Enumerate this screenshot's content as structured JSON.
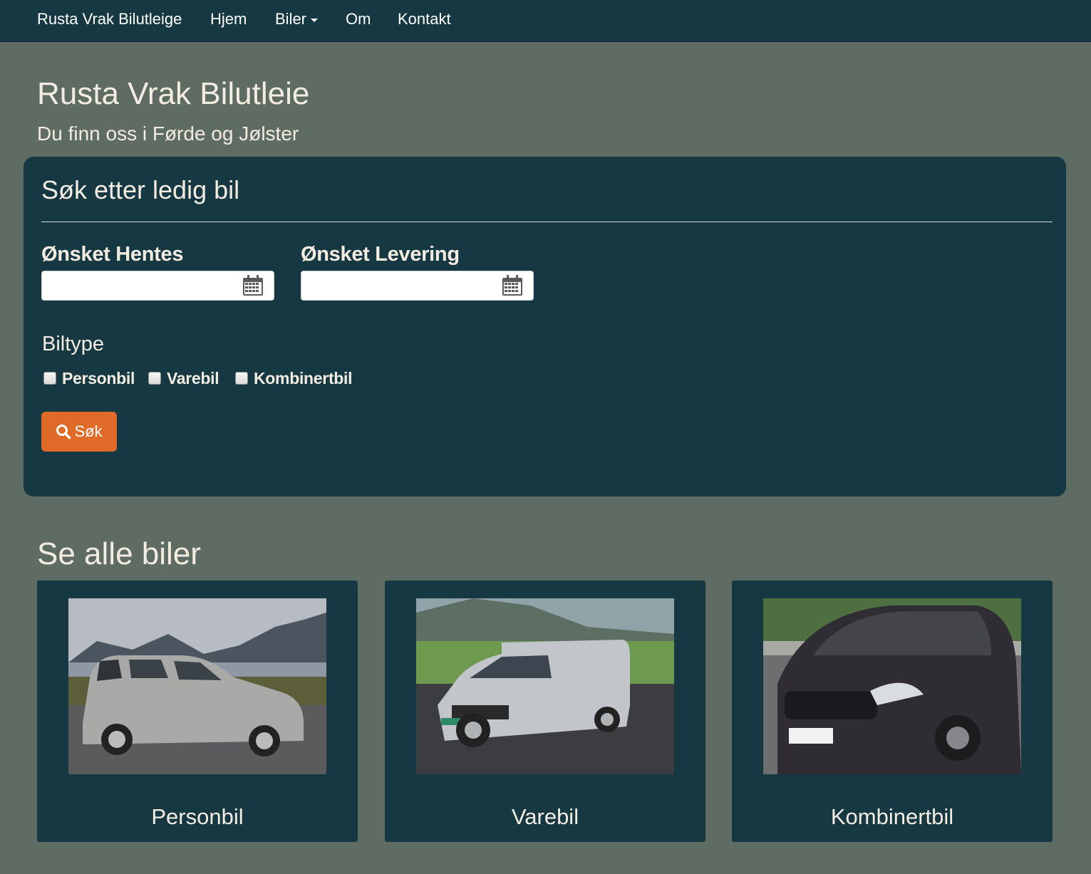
{
  "nav": {
    "brand": "Rusta Vrak Bilutleige",
    "items": [
      {
        "label": "Hjem"
      },
      {
        "label": "Biler",
        "dropdown": true
      },
      {
        "label": "Om"
      },
      {
        "label": "Kontakt"
      }
    ]
  },
  "header": {
    "title": "Rusta Vrak Bilutleie",
    "subtitle": "Du finn oss i Førde og Jølster"
  },
  "search": {
    "title": "Søk etter ledig bil",
    "pickup_label": "Ønsket Hentes",
    "pickup_value": "",
    "return_label": "Ønsket Levering",
    "return_value": "",
    "biltype_label": "Biltype",
    "options": [
      {
        "label": "Personbil",
        "checked": false
      },
      {
        "label": "Varebil",
        "checked": false
      },
      {
        "label": "Kombinertbil",
        "checked": false
      }
    ],
    "button_label": "Søk"
  },
  "cars": {
    "title": "Se alle biler",
    "items": [
      {
        "label": "Personbil",
        "color": "#a9a9a8"
      },
      {
        "label": "Varebil",
        "color": "#c2c6cb"
      },
      {
        "label": "Kombinertbil",
        "color": "#2f2c34"
      }
    ]
  },
  "colors": {
    "background": "#5e6c64",
    "panel": "#153843",
    "accent": "#e06a28",
    "text": "#f3ece0"
  }
}
